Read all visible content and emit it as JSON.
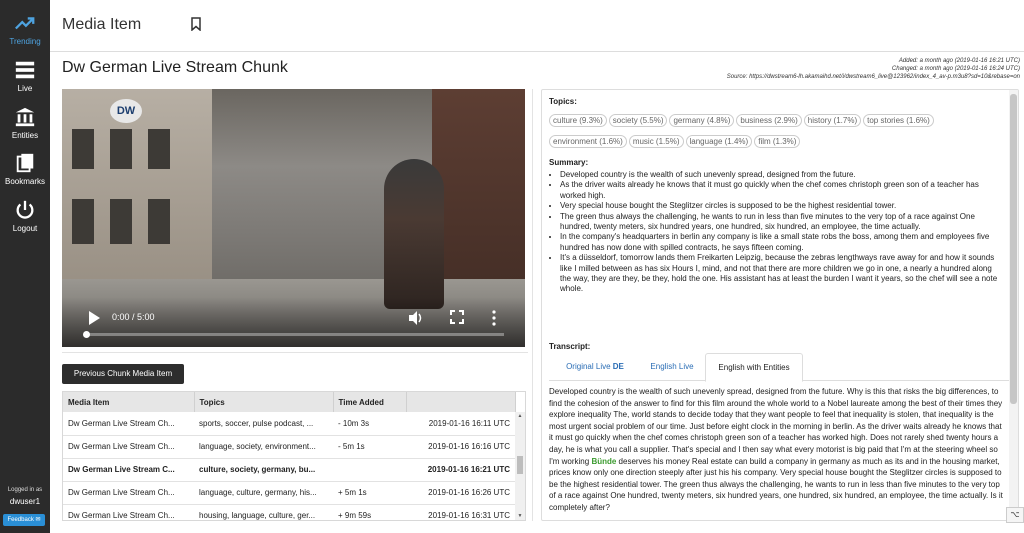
{
  "sidebar": {
    "items": [
      {
        "label": "Trending",
        "icon": "trending-icon"
      },
      {
        "label": "Live",
        "icon": "list-icon"
      },
      {
        "label": "Entities",
        "icon": "institution-icon"
      },
      {
        "label": "Bookmarks",
        "icon": "bookmarks-icon"
      },
      {
        "label": "Logout",
        "icon": "power-icon"
      }
    ],
    "logged_in_as": "Logged in as",
    "username": "dwuser1",
    "feedback_label": "Feedback"
  },
  "header": {
    "title": "Media Item"
  },
  "media": {
    "title": "Dw German Live Stream Chunk",
    "added": "Added: a month ago (2019-01-16 16:21 UTC)",
    "changed": "Changed: a month ago (2019-01-16 16:24 UTC)",
    "source": "Source: https://dwstream6-lh.akamaihd.net/i/dwstream6_live@123962/index_4_av-p.m3u8?sd=10&rebase=on"
  },
  "player": {
    "logo": "DW",
    "time": "0:00 / 5:00",
    "progress": 0.0
  },
  "prev_button": "Previous Chunk Media Item",
  "table": {
    "headers": [
      "Media Item",
      "Topics",
      "Time Added",
      ""
    ],
    "rows": [
      {
        "item": "Dw German Live Stream Ch...",
        "topics": "sports, soccer, pulse podcast, ...",
        "rel": "- 10m 3s",
        "date": "2019-01-16 16:11 UTC",
        "current": false
      },
      {
        "item": "Dw German Live Stream Ch...",
        "topics": "language, society, environment...",
        "rel": "- 5m 1s",
        "date": "2019-01-16 16:16 UTC",
        "current": false
      },
      {
        "item": "Dw German Live Stream C...",
        "topics": "culture, society, germany, bu...",
        "rel": "",
        "date": "2019-01-16 16:21 UTC",
        "current": true
      },
      {
        "item": "Dw German Live Stream Ch...",
        "topics": "language, culture, germany, his...",
        "rel": "+ 5m 1s",
        "date": "2019-01-16 16:26 UTC",
        "current": false
      },
      {
        "item": "Dw German Live Stream Ch...",
        "topics": "housing, language, culture, ger...",
        "rel": "+ 9m 59s",
        "date": "2019-01-16 16:31 UTC",
        "current": false
      }
    ]
  },
  "topics": {
    "label": "Topics:",
    "chips": [
      "culture (9.3%)",
      "society (5.5%)",
      "germany (4.8%)",
      "business (2.9%)",
      "history (1.7%)",
      "top stories (1.6%)",
      "environment (1.6%)",
      "music (1.5%)",
      "language (1.4%)",
      "film (1.3%)"
    ]
  },
  "summary": {
    "label": "Summary:",
    "items": [
      "Developed country is the wealth of such unevenly spread, designed from the future.",
      "As the driver waits already he knows that it must go quickly when the chef comes christoph green son of a teacher has worked high.",
      "Very special house bought the Steglitzer circles is supposed to be the highest residential tower.",
      "The green thus always the challenging, he wants to run in less than five minutes to the very top of a race against One hundred, twenty meters, six hundred years, one hundred, six hundred, an employee, the time actually.",
      "In the company's headquarters in berlin any company is like a small state robs the boss, among them and employees five hundred has now done with spilled contracts, he says fifteen coming.",
      "It's a düsseldorf, tomorrow lands them Freikarten Leipzig, because the zebras lengthways rave away for and how it sounds like I milled between as has six Hours I, mind, and not that there are more children we go in one, a nearly a hundred along the way, they are they, be they, hold the one. His assistant has at least the burden I want it years, so the chef will see a note whole."
    ]
  },
  "transcript": {
    "label": "Transcript:",
    "tabs": [
      {
        "label": "Original Live",
        "suffix": "DE"
      },
      {
        "label": "English Live",
        "suffix": ""
      },
      {
        "label": "English with Entities",
        "suffix": ""
      }
    ],
    "text_before": "Developed country is the wealth of such unevenly spread, designed from the future. Why is this that risks the big differences, to find the cohesion of the answer to find for this film around the whole world to a Nobel laureate among the best of their times they explore inequality The, world stands to decide today that they want people to feel that inequality is stolen, that inequality is the most urgent social problem of our time. Just before eight clock in the morning in berlin. As the driver waits already he knows that it must go quickly when the chef comes christoph green son of a teacher has worked high. Does not rarely shed twenty hours a day, he is what you call a supplier. That's special and I then say what every motorist is big paid that I'm at the steering wheel so I'm working ",
    "entity": "Bünde",
    "text_after": " deserves his money Real estate can build a company in germany as much as its and in the housing market, prices know only one direction steeply after just his his company. Very special house bought the Steglitzer circles is supposed to be the highest residential tower. The green thus always the challenging, he wants to run in less than five minutes to the very top of a race against One hundred, twenty meters, six hundred years, one hundred, six hundred, an employee, the time actually. Is it completely after?"
  },
  "colors": {
    "sidebar": "#2b2b2b",
    "accent": "#4ea3e0",
    "entity": "#3a9a2e",
    "link": "#2a6db5"
  }
}
